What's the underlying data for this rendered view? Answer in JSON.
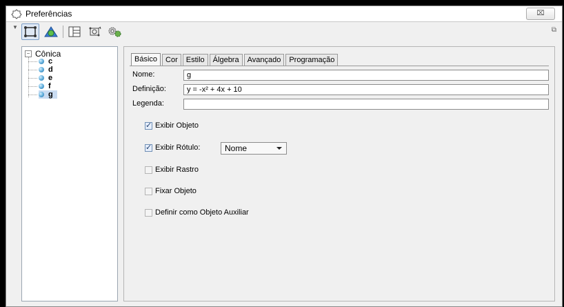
{
  "window": {
    "title": "Preferências",
    "close_glyph": "⌧"
  },
  "toolbar": {
    "icons": [
      "graphics-view-icon",
      "geometry-icon",
      "algebra-view-icon",
      "graphics2-view-icon",
      "settings-icon"
    ],
    "right_icon": "restore-icon"
  },
  "tree": {
    "root": "Cônica",
    "toggle": "−",
    "items": [
      {
        "label": "c",
        "selected": false
      },
      {
        "label": "d",
        "selected": false
      },
      {
        "label": "e",
        "selected": false
      },
      {
        "label": "f",
        "selected": false
      },
      {
        "label": "g",
        "selected": true
      }
    ]
  },
  "tabs": [
    {
      "label": "Básico",
      "active": true
    },
    {
      "label": "Cor",
      "active": false
    },
    {
      "label": "Estilo",
      "active": false
    },
    {
      "label": "Álgebra",
      "active": false
    },
    {
      "label": "Avançado",
      "active": false
    },
    {
      "label": "Programação",
      "active": false
    }
  ],
  "form": {
    "name_label": "Nome:",
    "name_value": "g",
    "definition_label": "Definição:",
    "definition_value": "y = -x² + 4x + 10",
    "caption_label": "Legenda:",
    "caption_value": ""
  },
  "checks": {
    "show_object": {
      "label": "Exibir Objeto",
      "checked": true
    },
    "show_label": {
      "label": "Exibir Rótulo:",
      "checked": true
    },
    "label_mode": "Nome",
    "show_trace": {
      "label": "Exibir Rastro",
      "checked": false
    },
    "fix_object": {
      "label": "Fixar Objeto",
      "checked": false
    },
    "auxiliary": {
      "label": "Definir como Objeto Auxiliar",
      "checked": false
    }
  }
}
